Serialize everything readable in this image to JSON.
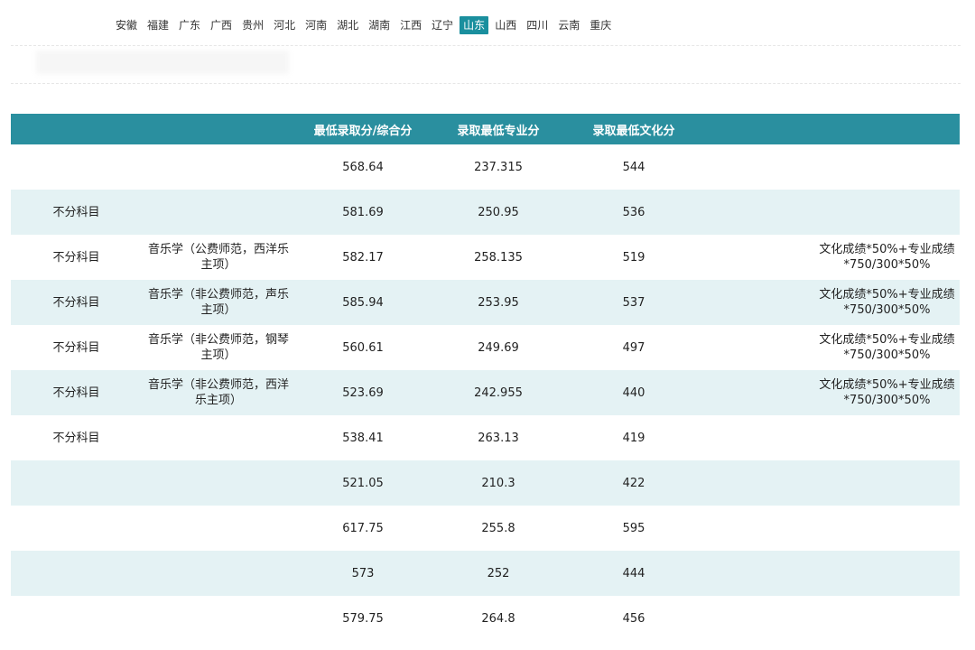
{
  "regions": [
    {
      "label": "安徽"
    },
    {
      "label": "福建"
    },
    {
      "label": "广东"
    },
    {
      "label": "广西"
    },
    {
      "label": "贵州"
    },
    {
      "label": "河北"
    },
    {
      "label": "河南"
    },
    {
      "label": "湖北"
    },
    {
      "label": "湖南"
    },
    {
      "label": "江西"
    },
    {
      "label": "辽宁"
    },
    {
      "label": "山东",
      "active": true
    },
    {
      "label": "山西"
    },
    {
      "label": "四川"
    },
    {
      "label": "云南"
    },
    {
      "label": "重庆"
    }
  ],
  "table": {
    "headers": [
      "",
      "",
      "最低录取分/综合分",
      "录取最低专业分",
      "录取最低文化分",
      "",
      ""
    ],
    "rows": [
      {
        "subject": "",
        "major": "",
        "min": "568.64",
        "pro": "237.315",
        "cul": "544",
        "rule": ""
      },
      {
        "subject": "不分科目",
        "major": "",
        "min": "581.69",
        "pro": "250.95",
        "cul": "536",
        "rule": ""
      },
      {
        "subject": "不分科目",
        "major": "音乐学（公费师范，西洋乐主项）",
        "min": "582.17",
        "pro": "258.135",
        "cul": "519",
        "rule": "文化成绩*50%+专业成绩*750/300*50%"
      },
      {
        "subject": "不分科目",
        "major": "音乐学（非公费师范，声乐主项）",
        "min": "585.94",
        "pro": "253.95",
        "cul": "537",
        "rule": "文化成绩*50%+专业成绩*750/300*50%"
      },
      {
        "subject": "不分科目",
        "major": "音乐学（非公费师范，钢琴主项）",
        "min": "560.61",
        "pro": "249.69",
        "cul": "497",
        "rule": "文化成绩*50%+专业成绩*750/300*50%"
      },
      {
        "subject": "不分科目",
        "major": "音乐学（非公费师范，西洋乐主项）",
        "min": "523.69",
        "pro": "242.955",
        "cul": "440",
        "rule": "文化成绩*50%+专业成绩*750/300*50%"
      },
      {
        "subject": "不分科目",
        "major": "",
        "min": "538.41",
        "pro": "263.13",
        "cul": "419",
        "rule": ""
      },
      {
        "subject": "",
        "major": "",
        "min": "521.05",
        "pro": "210.3",
        "cul": "422",
        "rule": ""
      },
      {
        "subject": "",
        "major": "",
        "min": "617.75",
        "pro": "255.8",
        "cul": "595",
        "rule": ""
      },
      {
        "subject": "",
        "major": "",
        "min": "573",
        "pro": "252",
        "cul": "444",
        "rule": ""
      },
      {
        "subject": "",
        "major": "",
        "min": "579.75",
        "pro": "264.8",
        "cul": "456",
        "rule": ""
      }
    ]
  }
}
